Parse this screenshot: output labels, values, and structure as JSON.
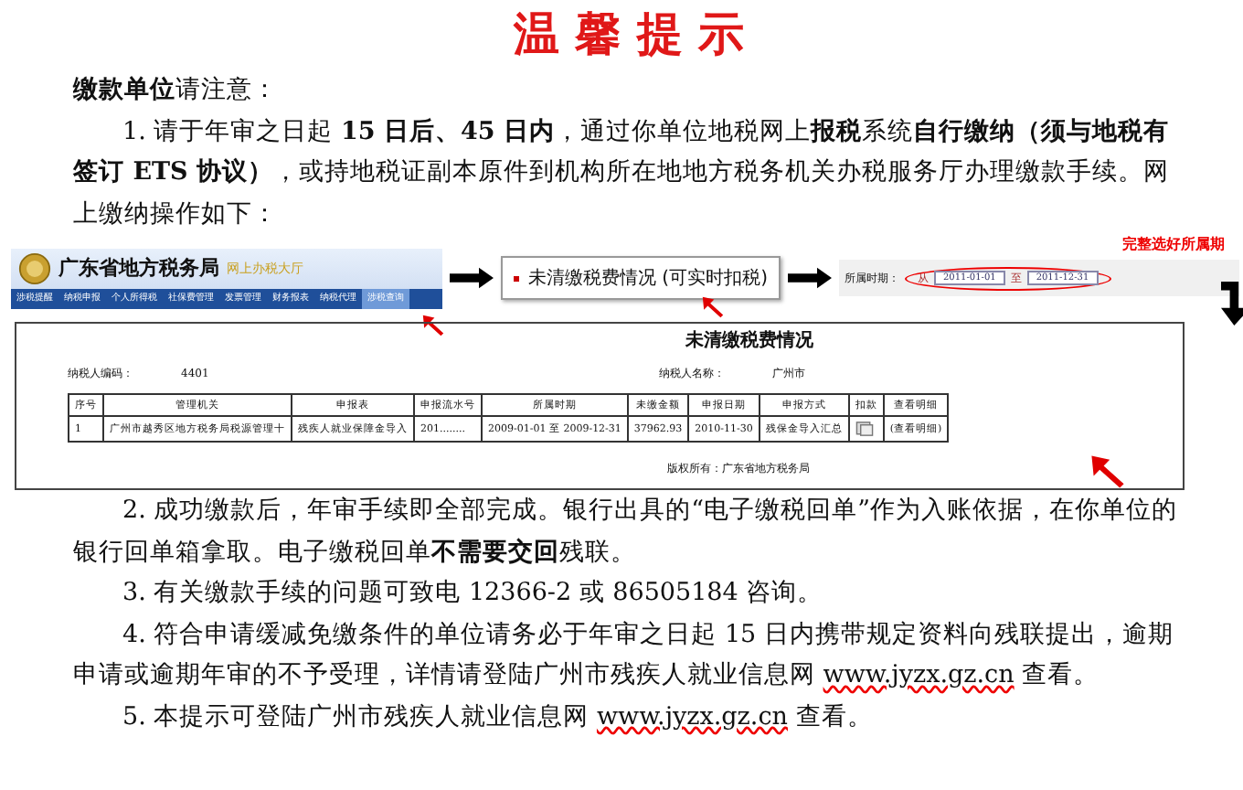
{
  "title": "温 馨 提 示",
  "greeting": "**缴款单位**请注意：",
  "item1": {
    "text": "1. 请于年审之日起 **15 日后、45 日内**，通过你单位地税网上**报税**系统**自行缴纳（须与地税有签订 ETS 协议）**，或持地税证副本原件到机构所在地地方税务机关办税服务厅办理缴款手续。网上缴纳操作如下："
  },
  "portal": {
    "name": "广东省地方税务局",
    "subtitle": "网上办税大厅",
    "nav": [
      {
        "label": "涉税提醒",
        "selected": false
      },
      {
        "label": "纳税申报",
        "selected": false
      },
      {
        "label": "个人所得税",
        "selected": false
      },
      {
        "label": "社保费管理",
        "selected": false
      },
      {
        "label": "发票管理",
        "selected": false
      },
      {
        "label": "财务报表",
        "selected": false
      },
      {
        "label": "纳税代理",
        "selected": false
      },
      {
        "label": "涉税查询",
        "selected": true
      }
    ]
  },
  "menu_link": "未清缴税费情况 (可实时扣税)",
  "period": {
    "label": "所属时期：",
    "from_label": "从",
    "from": "2011-01-01",
    "to_label": "至",
    "to": "2011-12-31",
    "note": "完整选好所属期"
  },
  "report": {
    "title": "未清缴税费情况",
    "code_label": "纳税人编码：",
    "code": "4401",
    "name_label": "纳税人名称：",
    "name": "广州市",
    "columns": [
      "序号",
      "管理机关",
      "申报表",
      "申报流水号",
      "所属时期",
      "未缴金额",
      "申报日期",
      "申报方式",
      "扣款",
      "查看明细"
    ],
    "rows": [
      {
        "cells": [
          "1",
          "广州市越秀区地方税务局税源管理十",
          "残疾人就业保障金导入",
          "201........",
          "2009-01-01 至 2009-12-31",
          "37962.93",
          "2010-11-30",
          "残保金导入汇总"
        ],
        "detail": "(查看明细)"
      }
    ],
    "footer": "版权所有：广东省地方税务局"
  },
  "items": [
    {
      "text": "2. 成功缴款后，年审手续即全部完成。银行出具的“电子缴税回单”作为入账依据，在你单位的银行回单箱拿取。电子缴税回单**不需要交回**残联。"
    },
    {
      "text": "3. 有关缴款手续的问题可致电 12366-2 或 86505184 咨询。"
    },
    {
      "text": "4. 符合申请缓减免缴条件的单位请务必于年审之日起 15 日内携带规定资料向残联提出，逾期申请或逾期年审的不予受理，详情请登陆广州市残疾人就业信息网 ",
      "link": "www.jyzx.gz.cn",
      "after": " 查看。"
    },
    {
      "text": "5. 本提示可登陆广州市残疾人就业信息网 ",
      "link": "www.jyzx.gz.cn",
      "after": " 查看。"
    }
  ]
}
